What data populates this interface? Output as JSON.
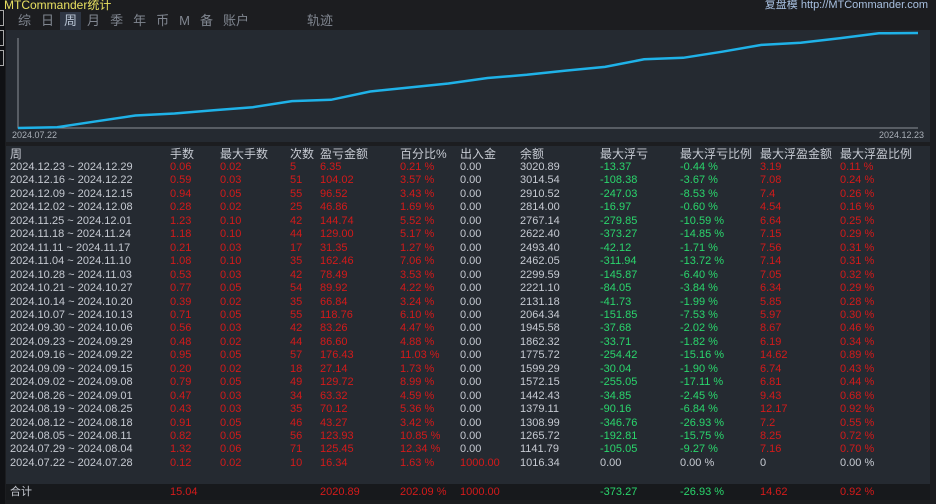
{
  "header": {
    "title": "MTCommander统计",
    "brand": "复盘模  http://MTCommander.com"
  },
  "tabs": [
    {
      "label": "综"
    },
    {
      "label": "日"
    },
    {
      "label": "周",
      "active": true
    },
    {
      "label": "月"
    },
    {
      "label": "季"
    },
    {
      "label": "年"
    },
    {
      "label": "币"
    },
    {
      "label": "M"
    },
    {
      "label": "备"
    },
    {
      "label": "账户"
    },
    {
      "label": "轨迹",
      "spacer": true
    }
  ],
  "chart": {
    "start_label": "2024.07.22",
    "end_label": "2024.12.23",
    "line_color": "#1fb2e8"
  },
  "table": {
    "columns": [
      "周",
      "手数",
      "最大手数",
      "次数",
      "盈亏金额",
      "百分比%",
      "出入金",
      "余额",
      "最大浮亏",
      "最大浮亏比例",
      "最大浮盈金额",
      "最大浮盈比例"
    ],
    "rows": [
      [
        "2024.12.23 ~ 2024.12.29",
        "0.06",
        "0.02",
        "5",
        "6.35",
        "0.21 %",
        "0.00",
        "3020.89",
        "-13.37",
        "-0.44 %",
        "3.19",
        "0.11 %"
      ],
      [
        "2024.12.16 ~ 2024.12.22",
        "0.59",
        "0.03",
        "51",
        "104.02",
        "3.57 %",
        "0.00",
        "3014.54",
        "-108.38",
        "-3.67 %",
        "7.08",
        "0.24 %"
      ],
      [
        "2024.12.09 ~ 2024.12.15",
        "0.94",
        "0.05",
        "55",
        "96.52",
        "3.43 %",
        "0.00",
        "2910.52",
        "-247.03",
        "-8.53 %",
        "7.4",
        "0.26 %"
      ],
      [
        "2024.12.02 ~ 2024.12.08",
        "0.28",
        "0.02",
        "25",
        "46.86",
        "1.69 %",
        "0.00",
        "2814.00",
        "-16.97",
        "-0.60 %",
        "4.54",
        "0.16 %"
      ],
      [
        "2024.11.25 ~ 2024.12.01",
        "1.23",
        "0.10",
        "42",
        "144.74",
        "5.52 %",
        "0.00",
        "2767.14",
        "-279.85",
        "-10.59 %",
        "6.64",
        "0.25 %"
      ],
      [
        "2024.11.18 ~ 2024.11.24",
        "1.18",
        "0.10",
        "44",
        "129.00",
        "5.17 %",
        "0.00",
        "2622.40",
        "-373.27",
        "-14.85 %",
        "7.15",
        "0.29 %"
      ],
      [
        "2024.11.11 ~ 2024.11.17",
        "0.21",
        "0.03",
        "17",
        "31.35",
        "1.27 %",
        "0.00",
        "2493.40",
        "-42.12",
        "-1.71 %",
        "7.56",
        "0.31 %"
      ],
      [
        "2024.11.04 ~ 2024.11.10",
        "1.08",
        "0.10",
        "35",
        "162.46",
        "7.06 %",
        "0.00",
        "2462.05",
        "-311.94",
        "-13.72 %",
        "7.14",
        "0.31 %"
      ],
      [
        "2024.10.28 ~ 2024.11.03",
        "0.53",
        "0.03",
        "42",
        "78.49",
        "3.53 %",
        "0.00",
        "2299.59",
        "-145.87",
        "-6.40 %",
        "7.05",
        "0.32 %"
      ],
      [
        "2024.10.21 ~ 2024.10.27",
        "0.77",
        "0.05",
        "54",
        "89.92",
        "4.22 %",
        "0.00",
        "2221.10",
        "-84.05",
        "-3.84 %",
        "6.34",
        "0.29 %"
      ],
      [
        "2024.10.14 ~ 2024.10.20",
        "0.39",
        "0.02",
        "35",
        "66.84",
        "3.24 %",
        "0.00",
        "2131.18",
        "-41.73",
        "-1.99 %",
        "5.85",
        "0.28 %"
      ],
      [
        "2024.10.07 ~ 2024.10.13",
        "0.71",
        "0.05",
        "55",
        "118.76",
        "6.10 %",
        "0.00",
        "2064.34",
        "-151.85",
        "-7.53 %",
        "5.97",
        "0.30 %"
      ],
      [
        "2024.09.30 ~ 2024.10.06",
        "0.56",
        "0.03",
        "42",
        "83.26",
        "4.47 %",
        "0.00",
        "1945.58",
        "-37.68",
        "-2.02 %",
        "8.67",
        "0.46 %"
      ],
      [
        "2024.09.23 ~ 2024.09.29",
        "0.48",
        "0.02",
        "44",
        "86.60",
        "4.88 %",
        "0.00",
        "1862.32",
        "-33.71",
        "-1.82 %",
        "6.19",
        "0.34 %"
      ],
      [
        "2024.09.16 ~ 2024.09.22",
        "0.95",
        "0.05",
        "57",
        "176.43",
        "11.03 %",
        "0.00",
        "1775.72",
        "-254.42",
        "-15.16 %",
        "14.62",
        "0.89 %"
      ],
      [
        "2024.09.09 ~ 2024.09.15",
        "0.20",
        "0.02",
        "18",
        "27.14",
        "1.73 %",
        "0.00",
        "1599.29",
        "-30.04",
        "-1.90 %",
        "6.74",
        "0.43 %"
      ],
      [
        "2024.09.02 ~ 2024.09.08",
        "0.79",
        "0.05",
        "49",
        "129.72",
        "8.99 %",
        "0.00",
        "1572.15",
        "-255.05",
        "-17.11 %",
        "6.81",
        "0.44 %"
      ],
      [
        "2024.08.26 ~ 2024.09.01",
        "0.47",
        "0.03",
        "34",
        "63.32",
        "4.59 %",
        "0.00",
        "1442.43",
        "-34.85",
        "-2.45 %",
        "9.43",
        "0.68 %"
      ],
      [
        "2024.08.19 ~ 2024.08.25",
        "0.43",
        "0.03",
        "35",
        "70.12",
        "5.36 %",
        "0.00",
        "1379.11",
        "-90.16",
        "-6.84 %",
        "12.17",
        "0.92 %"
      ],
      [
        "2024.08.12 ~ 2024.08.18",
        "0.91",
        "0.05",
        "46",
        "43.27",
        "3.42 %",
        "0.00",
        "1308.99",
        "-346.76",
        "-26.93 %",
        "7.2",
        "0.55 %"
      ],
      [
        "2024.08.05 ~ 2024.08.11",
        "0.82",
        "0.05",
        "56",
        "123.93",
        "10.85 %",
        "0.00",
        "1265.72",
        "-192.81",
        "-15.75 %",
        "8.25",
        "0.72 %"
      ],
      [
        "2024.07.29 ~ 2024.08.04",
        "1.32",
        "0.06",
        "71",
        "125.45",
        "12.34 %",
        "0.00",
        "1141.79",
        "-105.05",
        "-9.27 %",
        "7.16",
        "0.70 %"
      ],
      [
        "2024.07.22 ~ 2024.07.28",
        "0.12",
        "0.02",
        "10",
        "16.34",
        "1.63 %",
        "1000.00",
        "1016.34",
        "0.00",
        "0.00 %",
        "0",
        "0.00 %"
      ]
    ],
    "total": [
      "合计",
      "15.04",
      "",
      "",
      "2020.89",
      "202.09 %",
      "1000.00",
      "",
      "-373.27",
      "-26.93 %",
      "14.62",
      "0.92 %"
    ]
  }
}
